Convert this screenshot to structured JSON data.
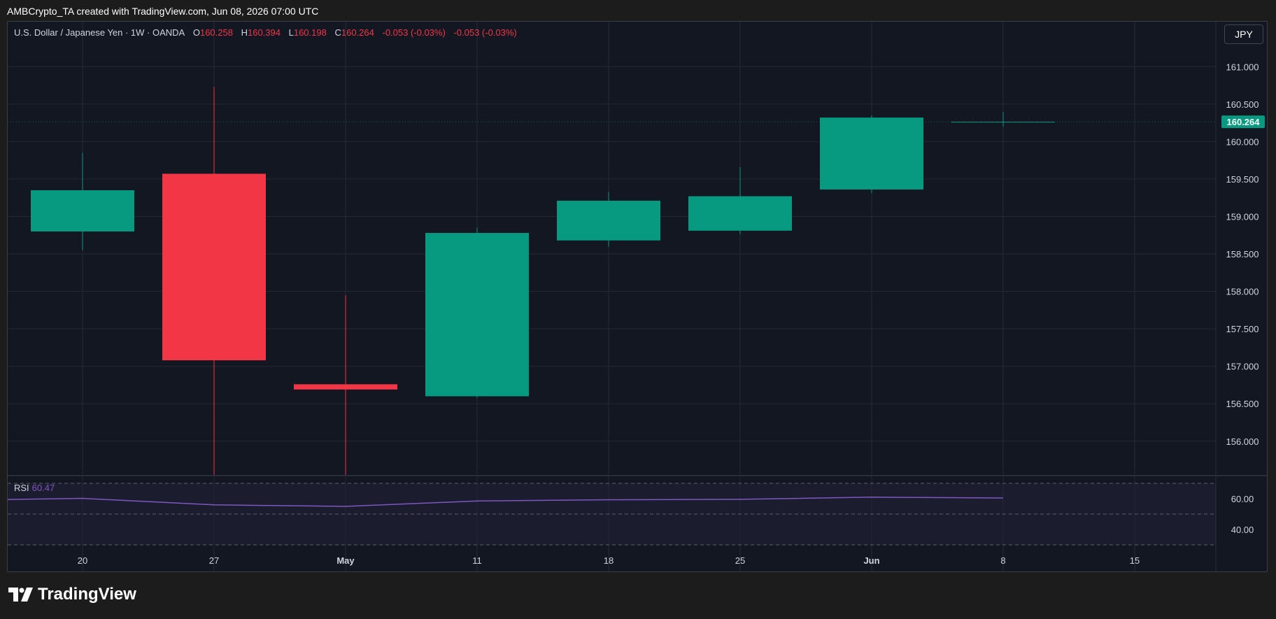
{
  "header": {
    "attribution": "AMBCrypto_TA created with TradingView.com, Jun 08, 2026 07:00 UTC"
  },
  "legend": {
    "symbol_text": "U.S. Dollar / Japanese Yen · 1W · OANDA",
    "open_label": "O",
    "open_value": "160.258",
    "high_label": "H",
    "high_value": "160.394",
    "low_label": "L",
    "low_value": "160.198",
    "close_label": "C",
    "close_value": "160.264",
    "change_1": "-0.053 (-0.03%)",
    "change_2": "-0.053 (-0.03%)"
  },
  "currency_button": "JPY",
  "rsi": {
    "label": "RSI",
    "value": "60.47"
  },
  "brand": {
    "name": "TradingView"
  },
  "colors": {
    "up": "#089981",
    "down": "#f23645",
    "background": "#131722",
    "grid": "#242936",
    "rsi_line": "#7e57c2",
    "axis_text": "#d1d4dc"
  },
  "chart_data": {
    "type": "candlestick",
    "title": "U.S. Dollar / Japanese Yen · 1W · OANDA",
    "x_ticks": [
      "20",
      "27",
      "May",
      "11",
      "18",
      "25",
      "Jun",
      "8",
      "15"
    ],
    "y_ticks": [
      156.0,
      156.5,
      157.0,
      157.5,
      158.0,
      158.5,
      159.0,
      159.5,
      160.0,
      160.5,
      161.0
    ],
    "ylim": [
      155.55,
      161.6
    ],
    "price_label": "160.264",
    "candles": [
      {
        "week": "20",
        "open": 158.8,
        "high": 159.85,
        "low": 158.55,
        "close": 159.35
      },
      {
        "week": "27",
        "open": 159.57,
        "high": 160.73,
        "low": 155.55,
        "close": 157.08
      },
      {
        "week": "May",
        "open": 156.76,
        "high": 157.95,
        "low": 155.55,
        "close": 156.69
      },
      {
        "week": "11",
        "open": 156.6,
        "high": 158.85,
        "low": 156.58,
        "close": 158.78
      },
      {
        "week": "18",
        "open": 158.68,
        "high": 159.33,
        "low": 158.6,
        "close": 159.21
      },
      {
        "week": "25",
        "open": 158.81,
        "high": 159.66,
        "low": 158.76,
        "close": 159.27
      },
      {
        "week": "Jun",
        "open": 159.36,
        "high": 160.35,
        "low": 159.31,
        "close": 160.32
      },
      {
        "week": "8",
        "open": 160.258,
        "high": 160.394,
        "low": 160.198,
        "close": 160.264
      }
    ],
    "rsi": {
      "label": "RSI",
      "y_ticks": [
        40.0,
        60.0
      ],
      "upper_band": 70,
      "middle": 50,
      "lower_band": 30,
      "values": [
        59.5,
        60.2,
        56.0,
        55.0,
        58.5,
        59.3,
        59.6,
        61.0,
        60.47
      ]
    }
  }
}
